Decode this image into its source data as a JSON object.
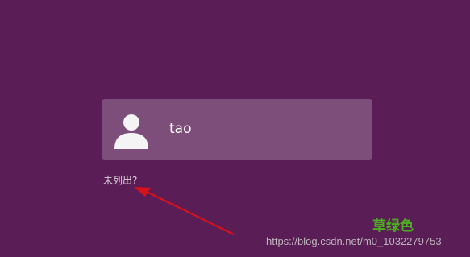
{
  "login": {
    "username": "tao",
    "not_listed_label": "未列出?"
  },
  "annotation": {
    "caption": "草绿色",
    "arrow_color": "#d7121b"
  },
  "watermark": {
    "text": "https://blog.csdn.net/m0_1032279753"
  },
  "colors": {
    "background": "#5a1d56",
    "card": "rgba(255,255,255,0.22)",
    "caption": "#4caf1f"
  },
  "icons": {
    "avatar": "user-avatar-icon"
  }
}
